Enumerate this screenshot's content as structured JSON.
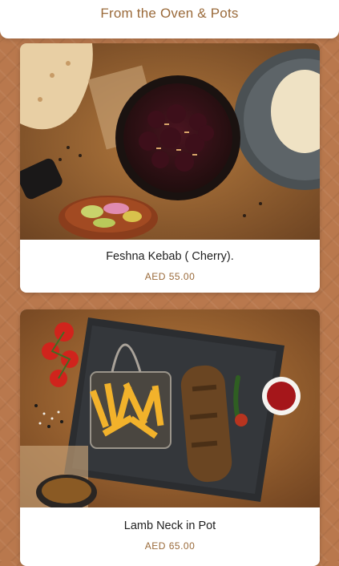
{
  "header": {
    "title": "From the Oven & Pots"
  },
  "menu_items": [
    {
      "name": "Feshna Kebab ( Cherry).",
      "price": "AED 55.00"
    },
    {
      "name": "Lamb Neck in Pot",
      "price": "AED 65.00"
    }
  ],
  "colors": {
    "accent": "#9a6a3a",
    "background": "#b9784d",
    "card": "#ffffff"
  }
}
